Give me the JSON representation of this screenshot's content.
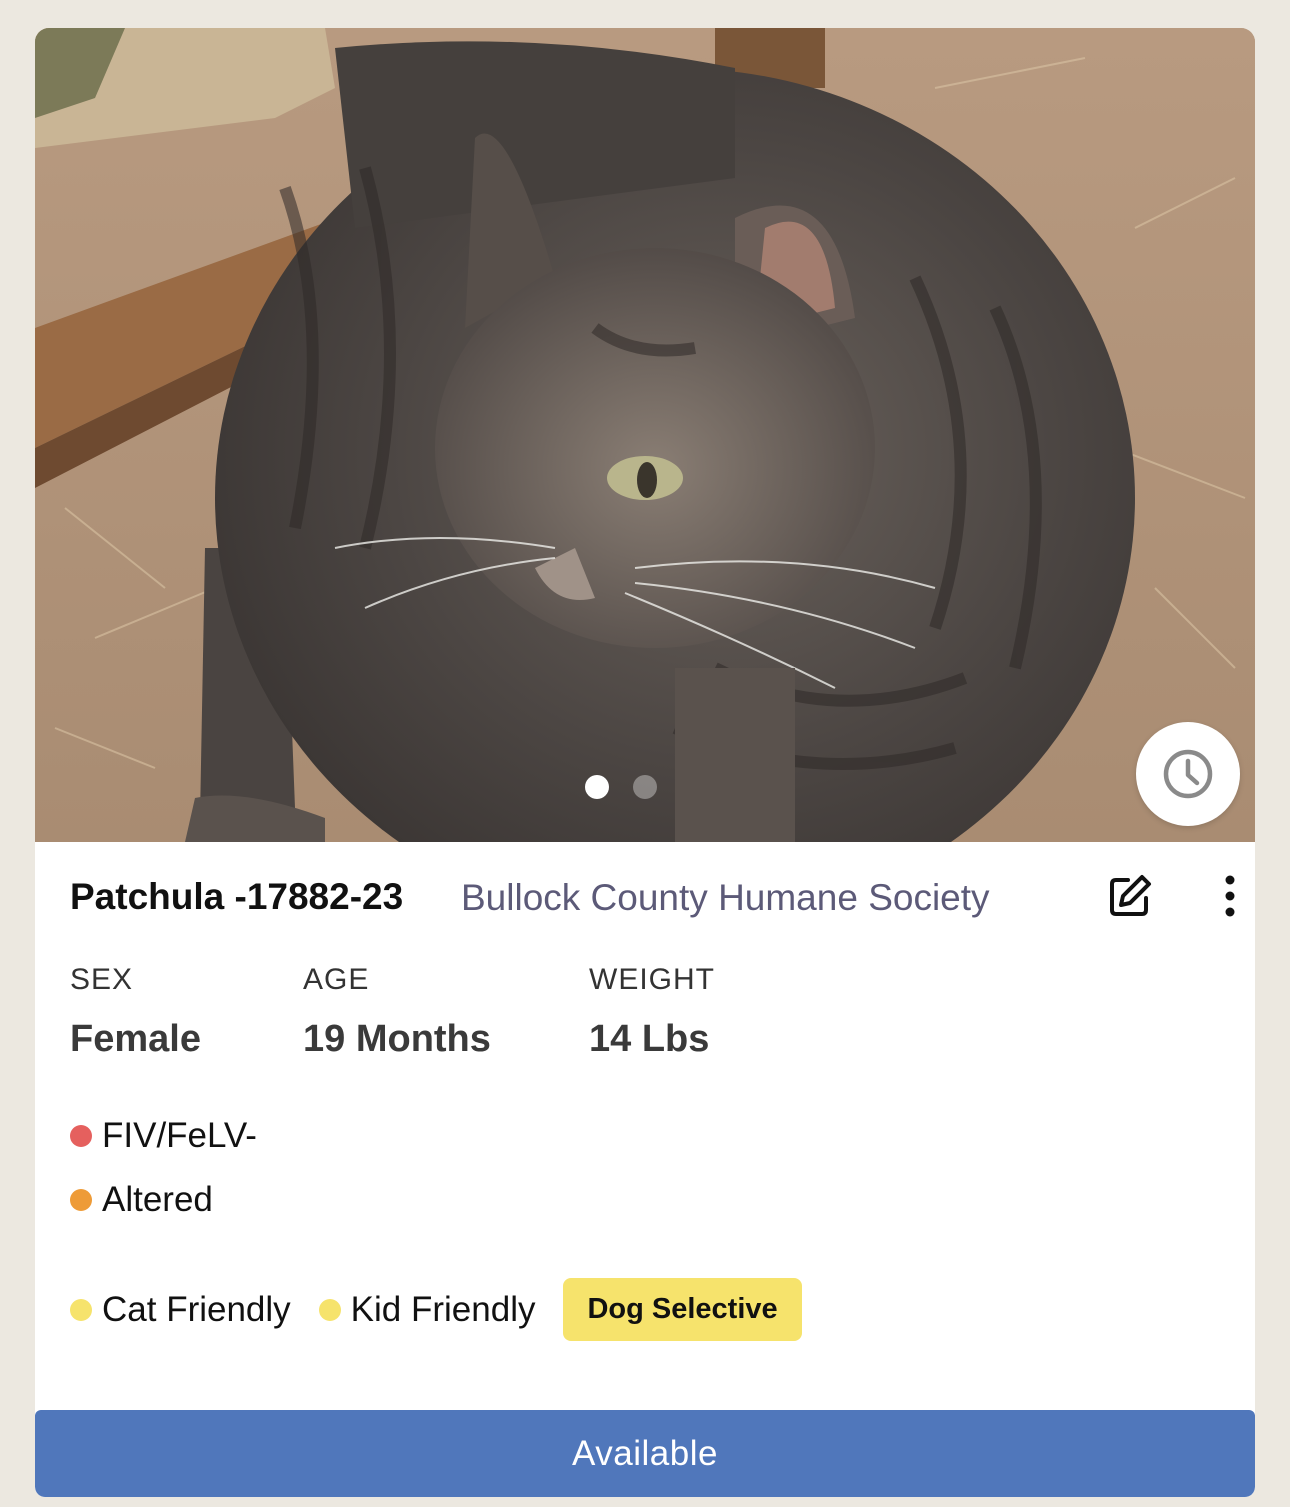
{
  "pet": {
    "name": "Patchula -17882-23",
    "shelter": "Bullock County Humane Society",
    "photo_count": 2,
    "active_photo": 1
  },
  "stats": {
    "sex_label": "SEX",
    "sex_value": "Female",
    "age_label": "AGE",
    "age_value": "19 Months",
    "weight_label": "WEIGHT",
    "weight_value": "14 Lbs"
  },
  "health": [
    {
      "label": "FIV/FeLV-",
      "color": "#e5605e"
    },
    {
      "label": "Altered",
      "color": "#ee9b37"
    }
  ],
  "traits": [
    {
      "label": "Cat Friendly",
      "color": "#f6e36c"
    },
    {
      "label": "Kid Friendly",
      "color": "#f6e36c"
    }
  ],
  "badge": {
    "label": "Dog Selective",
    "color": "#f6e36c"
  },
  "status_button": {
    "label": "Available",
    "color": "#5077bb"
  },
  "icons": [
    "clock-icon",
    "edit-icon",
    "more-vertical-icon"
  ]
}
